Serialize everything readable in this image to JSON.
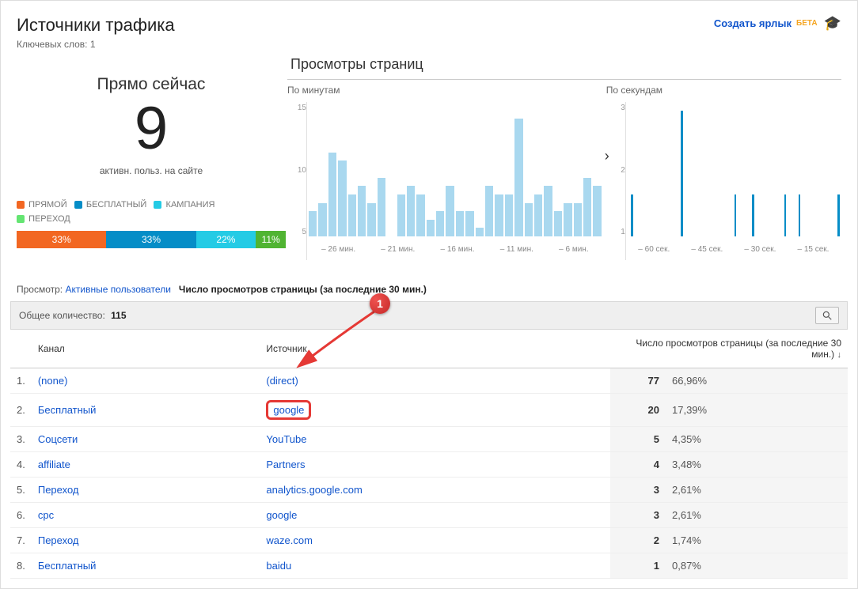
{
  "header": {
    "title": "Источники трафика",
    "subtitle_label": "Ключевых слов:",
    "subtitle_value": "1",
    "create_shortcut": "Создать ярлык",
    "beta": "БЕТА"
  },
  "realtime": {
    "now_label": "Прямо сейчас",
    "count": "9",
    "active_label": "активн. польз. на сайте",
    "legend": {
      "direct": "ПРЯМОЙ",
      "free": "БЕСПЛАТНЫЙ",
      "campaign": "КАМПАНИЯ",
      "referral": "ПЕРЕХОД"
    },
    "percents": {
      "p1": "33%",
      "p2": "33%",
      "p3": "22%",
      "p4": "11%"
    }
  },
  "pageviews": {
    "section_title": "Просмотры страниц",
    "minutes_label": "По минутам",
    "seconds_label": "По секундам"
  },
  "chart_data": [
    {
      "type": "bar",
      "name": "minutes",
      "title": "По минутам",
      "ylabel": "",
      "ylim": [
        0,
        16
      ],
      "yticks": [
        5,
        10,
        15
      ],
      "categories": [
        "– 26 мин.",
        "– 21 мин.",
        "– 16 мин.",
        "– 11 мин.",
        "– 6 мин."
      ],
      "values": [
        3,
        4,
        10,
        9,
        5,
        6,
        4,
        7,
        0,
        5,
        6,
        5,
        2,
        3,
        6,
        3,
        3,
        1,
        6,
        5,
        5,
        14,
        4,
        5,
        6,
        3,
        4,
        4,
        7,
        6
      ]
    },
    {
      "type": "bar",
      "name": "seconds",
      "title": "По секундам",
      "ylabel": "",
      "ylim": [
        0,
        3.2
      ],
      "yticks": [
        1,
        2,
        3
      ],
      "categories": [
        "– 60 сек.",
        "– 45 сек.",
        "– 30 сек.",
        "– 15 сек."
      ],
      "values": [
        0,
        1,
        0,
        0,
        0,
        0,
        0,
        0,
        0,
        0,
        0,
        0,
        0,
        0,
        0,
        3,
        0,
        0,
        0,
        0,
        0,
        0,
        0,
        0,
        0,
        0,
        0,
        0,
        0,
        0,
        1,
        0,
        0,
        0,
        0,
        1,
        0,
        0,
        0,
        0,
        0,
        0,
        0,
        0,
        1,
        0,
        0,
        0,
        1,
        0,
        0,
        0,
        0,
        0,
        0,
        0,
        0,
        0,
        0,
        1
      ]
    }
  ],
  "toggle": {
    "view_label": "Просмотр:",
    "active_users": "Активные пользователи",
    "pageviews_30": "Число просмотров страницы (за последние 30 мин.)"
  },
  "totals": {
    "label": "Общее количество:",
    "value": "115"
  },
  "table": {
    "col_channel": "Канал",
    "col_source": "Источник",
    "col_metric": "Число просмотров страницы (за последние 30 мин.)",
    "rows": [
      {
        "idx": "1.",
        "channel": "(none)",
        "source": "(direct)",
        "count": "77",
        "pct": "66,96%"
      },
      {
        "idx": "2.",
        "channel": "Бесплатный",
        "source": "google",
        "count": "20",
        "pct": "17,39%"
      },
      {
        "idx": "3.",
        "channel": "Соцсети",
        "source": "YouTube",
        "count": "5",
        "pct": "4,35%"
      },
      {
        "idx": "4.",
        "channel": "affiliate",
        "source": "Partners",
        "count": "4",
        "pct": "3,48%"
      },
      {
        "idx": "5.",
        "channel": "Переход",
        "source": "analytics.google.com",
        "count": "3",
        "pct": "2,61%"
      },
      {
        "idx": "6.",
        "channel": "cpc",
        "source": "google",
        "count": "3",
        "pct": "2,61%"
      },
      {
        "idx": "7.",
        "channel": "Переход",
        "source": "waze.com",
        "count": "2",
        "pct": "1,74%"
      },
      {
        "idx": "8.",
        "channel": "Бесплатный",
        "source": "baidu",
        "count": "1",
        "pct": "0,87%"
      }
    ]
  },
  "annotation": {
    "badge": "1"
  }
}
